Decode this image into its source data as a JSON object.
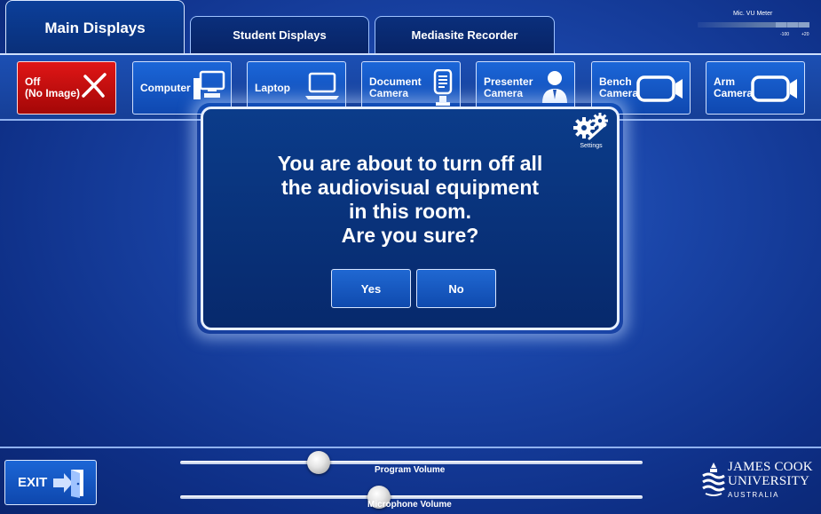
{
  "tabs": {
    "main": "Main Displays",
    "student": "Student Displays",
    "mediasite": "Mediasite Recorder"
  },
  "vu_meter": {
    "title": "Mic. VU Meter",
    "low_label": "-100",
    "high_label": "+20"
  },
  "sources": [
    {
      "label": "Off\n(No Image)",
      "icon": "x-icon",
      "active": true
    },
    {
      "label": "Computer",
      "icon": "computer-icon"
    },
    {
      "label": "Laptop",
      "icon": "laptop-icon"
    },
    {
      "label": "Document\nCamera",
      "icon": "document-camera-icon"
    },
    {
      "label": "Presenter\nCamera",
      "icon": "presenter-icon"
    },
    {
      "label": "Bench\nCamera",
      "icon": "camera-icon"
    },
    {
      "label": "Arm\nCamera",
      "icon": "camera-icon"
    }
  ],
  "dialog": {
    "message": "You are about to turn off all\nthe audiovisual equipment\nin this room.\nAre you sure?",
    "yes_label": "Yes",
    "no_label": "No",
    "settings_label": "Settings"
  },
  "bottom": {
    "exit_label": "EXIT",
    "program_volume_label": "Program Volume",
    "program_volume_level": 0.3,
    "microphone_volume_label": "Microphone Volume",
    "microphone_volume_level": 0.43
  },
  "logo": {
    "line1": "JAMES COOK",
    "line2": "UNIVERSITY",
    "line3": "AUSTRALIA"
  },
  "colors": {
    "background": "#1a45a8",
    "button_blue": "#1b66d8",
    "off_red": "#e01616",
    "dialog_bg": "#0b3c8a"
  }
}
